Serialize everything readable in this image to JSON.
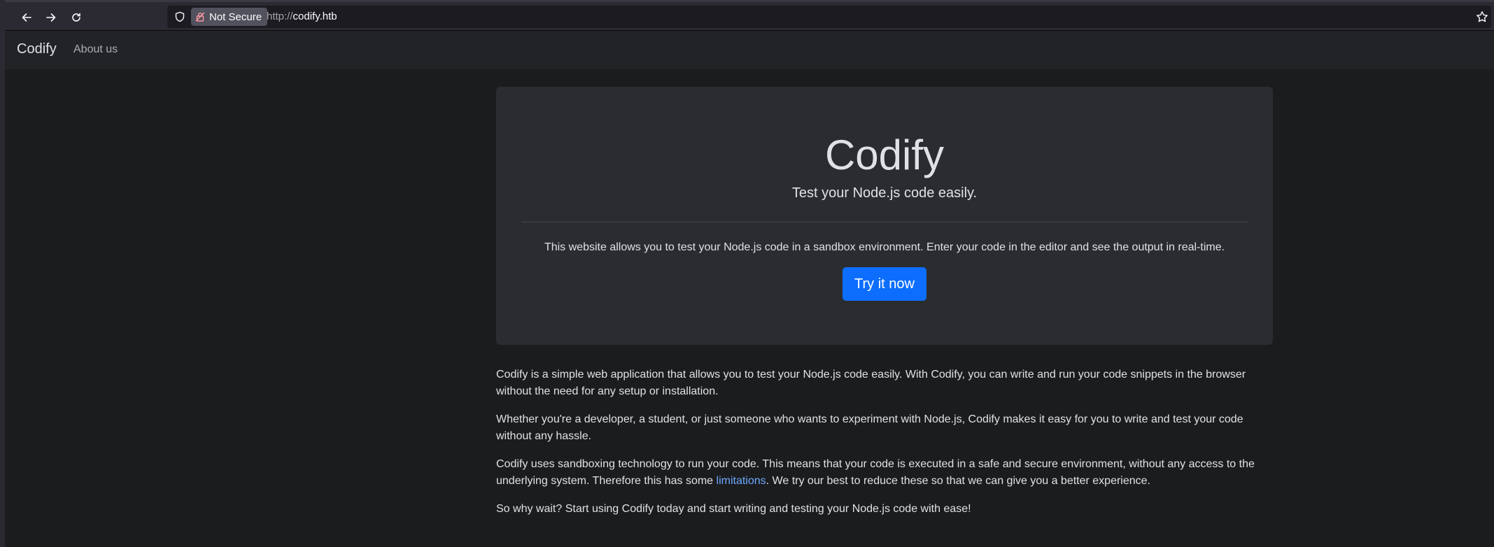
{
  "browser": {
    "security_label": "Not Secure",
    "url_protocol": "http://",
    "url_host": "codify.htb",
    "icons": [
      "back-arrow-icon",
      "forward-arrow-icon",
      "reload-icon",
      "shield-icon",
      "insecure-lock-icon",
      "bookmark-star-icon"
    ]
  },
  "navbar": {
    "brand": "Codify",
    "links": [
      {
        "label": "About us"
      }
    ]
  },
  "hero": {
    "title": "Codify",
    "lead": "Test your Node.js code easily.",
    "description": "This website allows you to test your Node.js code in a sandbox environment. Enter your code in the editor and see the output in real-time.",
    "button_label": "Try it now"
  },
  "content": {
    "p1": "Codify is a simple web application that allows you to test your Node.js code easily. With Codify, you can write and run your code snippets in the browser without the need for any setup or installation.",
    "p2": "Whether you're a developer, a student, or just someone who wants to experiment with Node.js, Codify makes it easy for you to write and test your code without any hassle.",
    "p3_before": "Codify uses sandboxing technology to run your code. This means that your code is executed in a safe and secure environment, without any access to the underlying system. Therefore this has some ",
    "p3_link": "limitations",
    "p3_after": ". We try our best to reduce these so that we can give you a better experience.",
    "p4": "So why wait? Start using Codify today and start writing and testing your Node.js code with ease!"
  },
  "colors": {
    "accent": "#0d6efd",
    "link": "#6ea8fe",
    "page_bg": "#1b1c1e",
    "hero_bg": "#2b2c2f"
  }
}
